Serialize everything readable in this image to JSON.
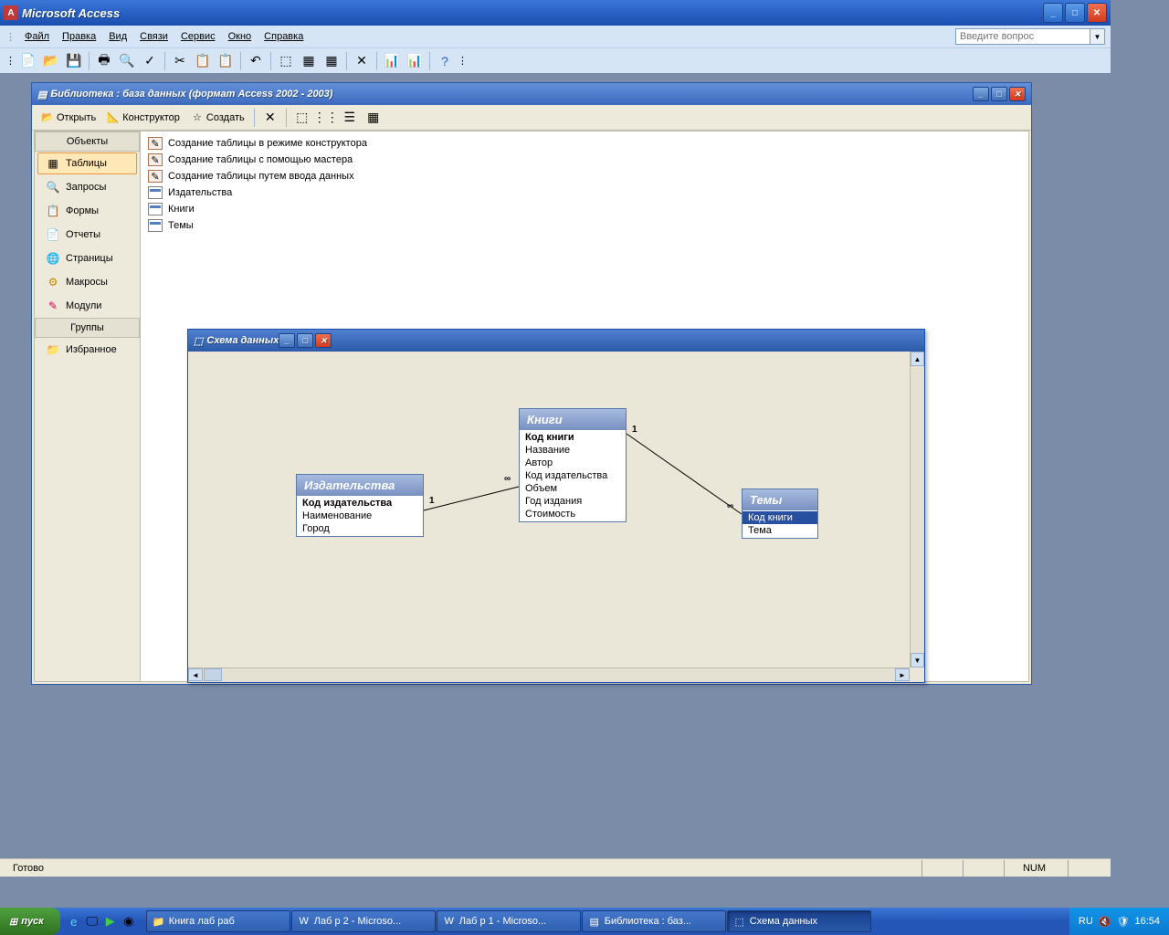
{
  "app": {
    "title": "Microsoft Access"
  },
  "menu": {
    "items": [
      "Файл",
      "Правка",
      "Вид",
      "Связи",
      "Сервис",
      "Окно",
      "Справка"
    ],
    "help_placeholder": "Введите вопрос"
  },
  "db_window": {
    "title": "Библиотека : база данных (формат Access 2002 - 2003)",
    "toolbar": {
      "open": "Открыть",
      "design": "Конструктор",
      "create": "Создать"
    },
    "nav": {
      "objects_header": "Объекты",
      "groups_header": "Группы",
      "items": [
        "Таблицы",
        "Запросы",
        "Формы",
        "Отчеты",
        "Страницы",
        "Макросы",
        "Модули"
      ],
      "favorites": "Избранное"
    },
    "list": [
      "Создание таблицы в режиме конструктора",
      "Создание таблицы с помощью мастера",
      "Создание таблицы путем ввода данных",
      "Издательства",
      "Книги",
      "Темы"
    ]
  },
  "schema": {
    "title": "Схема данных",
    "tables": {
      "publishers": {
        "title": "Издательства",
        "fields": [
          "Код издательства",
          "Наименование",
          "Город"
        ]
      },
      "books": {
        "title": "Книги",
        "fields": [
          "Код книги",
          "Название",
          "Автор",
          "Код издательства",
          "Объем",
          "Год издания",
          "Стоимость"
        ]
      },
      "topics": {
        "title": "Темы",
        "fields": [
          "Код книги",
          "Тема"
        ]
      }
    },
    "rel_labels": {
      "one": "1",
      "many": "∞"
    }
  },
  "status": {
    "ready": "Готово",
    "num": "NUM"
  },
  "taskbar": {
    "start": "пуск",
    "tasks": [
      "Книга лаб раб",
      "Лаб р 2 - Microso...",
      "Лаб р 1 - Microso...",
      "Библиотека : баз...",
      "Схема данных"
    ],
    "lang": "RU",
    "time": "16:54"
  }
}
